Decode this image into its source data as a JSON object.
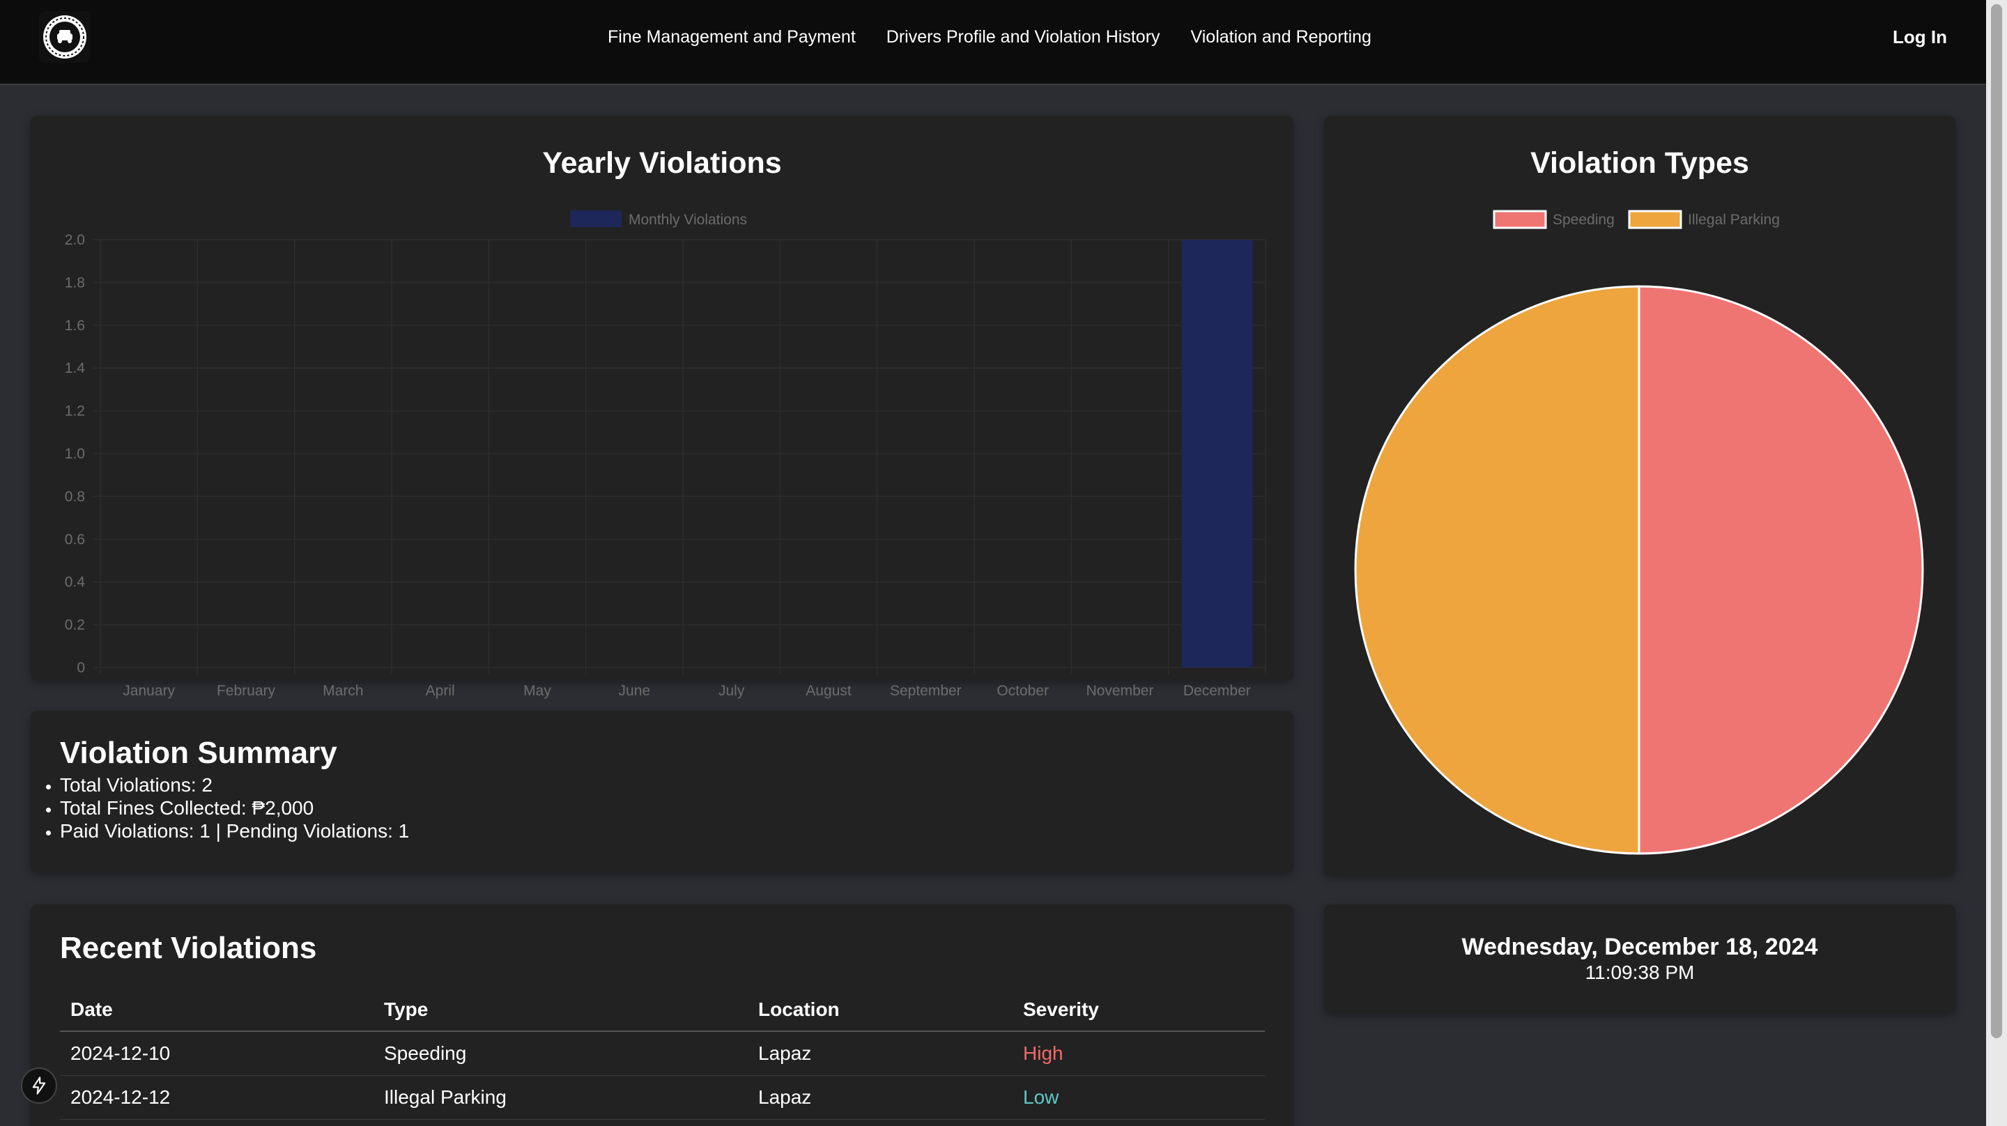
{
  "nav": {
    "links": [
      "Fine Management and Payment",
      "Drivers Profile and Violation History",
      "Violation and Reporting"
    ],
    "login": "Log In"
  },
  "yearly": {
    "title": "Yearly Violations",
    "legend": "Monthly Violations"
  },
  "types": {
    "title": "Violation Types",
    "legend": [
      "Speeding",
      "Illegal Parking"
    ]
  },
  "summary": {
    "title": "Violation Summary",
    "items": [
      "Total Violations: 2",
      "Total Fines Collected: ₱2,000",
      "Paid Violations: 1 | Pending Violations: 1"
    ]
  },
  "recent": {
    "title": "Recent Violations",
    "headers": [
      "Date",
      "Type",
      "Location",
      "Severity"
    ],
    "rows": [
      {
        "date": "2024-12-10",
        "type": "Speeding",
        "location": "Lapaz",
        "severity": "High"
      },
      {
        "date": "2024-12-12",
        "type": "Illegal Parking",
        "location": "Lapaz",
        "severity": "Low"
      }
    ]
  },
  "clock": {
    "date": "Wednesday, December 18, 2024",
    "time": "11:09:38 PM"
  },
  "colors": {
    "bar": "#1e2759",
    "speeding": "#ef7573",
    "illegal_parking": "#eea53e",
    "severity_high": "#ef6b68",
    "severity_low": "#5fc9c9"
  },
  "chart_data": [
    {
      "type": "bar",
      "title": "Yearly Violations",
      "categories": [
        "January",
        "February",
        "March",
        "April",
        "May",
        "June",
        "July",
        "August",
        "September",
        "October",
        "November",
        "December"
      ],
      "series": [
        {
          "name": "Monthly Violations",
          "values": [
            0,
            0,
            0,
            0,
            0,
            0,
            0,
            0,
            0,
            0,
            0,
            2
          ]
        }
      ],
      "ylim": [
        0,
        2.0
      ],
      "yticks": [
        "0",
        "0.2",
        "0.4",
        "0.6",
        "0.8",
        "1.0",
        "1.2",
        "1.4",
        "1.6",
        "1.8",
        "2.0"
      ],
      "legend": "top"
    },
    {
      "type": "pie",
      "title": "Violation Types",
      "labels": [
        "Speeding",
        "Illegal Parking"
      ],
      "values": [
        1,
        1
      ],
      "legend": "top"
    }
  ]
}
